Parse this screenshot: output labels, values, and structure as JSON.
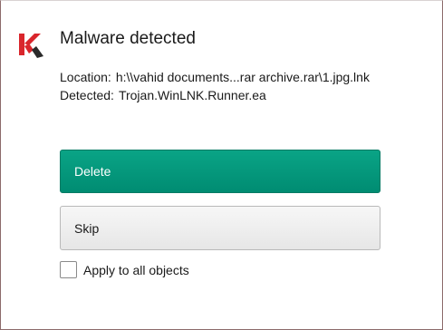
{
  "dialog": {
    "title": "Malware detected",
    "logo_icon": "kaspersky-logo-icon",
    "brand_color": "#d9262c",
    "location_label": "Location:",
    "location_value": "h:\\\\vahid documents...rar archive.rar\\1.jpg.lnk",
    "detected_label": "Detected:",
    "detected_value": "Trojan.WinLNK.Runner.ea"
  },
  "actions": {
    "delete_label": "Delete",
    "delete_color": "#009679",
    "skip_label": "Skip"
  },
  "options": {
    "apply_all_label": "Apply to all objects",
    "apply_all_checked": false
  }
}
